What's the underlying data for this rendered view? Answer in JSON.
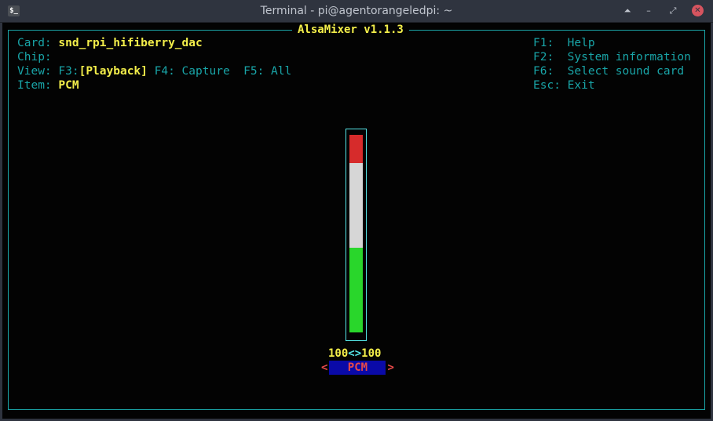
{
  "window": {
    "title": "Terminal - pi@agentorangeledpi: ~",
    "app_icon": "$_",
    "buttons": {
      "shade": "⏶",
      "minimize": "–",
      "maximize": "⤢",
      "close": "✕"
    }
  },
  "alsamixer": {
    "title": "AlsaMixer v1.1.3",
    "info": {
      "card_label": "Card:",
      "card_value": "snd_rpi_hifiberry_dac",
      "chip_label": "Chip:",
      "chip_value": "",
      "view_label": "View:",
      "view_f3_key": "F3:",
      "view_f3_value": "[Playback]",
      "view_f4": "F4: Capture",
      "view_f5": "F5: All",
      "item_label": "Item:",
      "item_value": "PCM"
    },
    "help": [
      {
        "key": "F1:",
        "label": "Help"
      },
      {
        "key": "F2:",
        "label": "System information"
      },
      {
        "key": "F6:",
        "label": "Select sound card"
      },
      {
        "key": "Esc:",
        "label": "Exit"
      }
    ],
    "control": {
      "name": "PCM",
      "left_value": "100",
      "separator": "<>",
      "right_value": "100",
      "level_percent": 100,
      "arrow_left": "<",
      "arrow_right": ">"
    }
  }
}
